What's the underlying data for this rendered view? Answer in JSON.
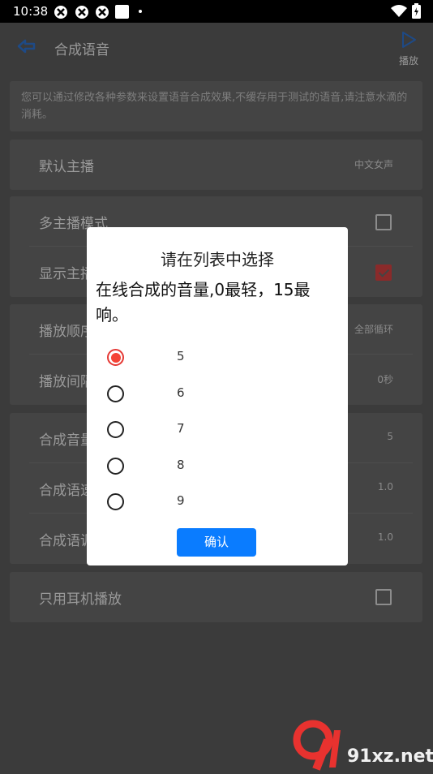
{
  "status_bar": {
    "time": "10:38"
  },
  "toolbar": {
    "title": "合成语音",
    "play_label": "播放"
  },
  "description": "您可以通过修改各种参数来设置语音合成效果,不缓存用于测试的语音,请注意水滴的消耗。",
  "settings": {
    "default_voice": {
      "label": "默认主播",
      "value": "中文女声"
    },
    "multi_voice": {
      "label": "多主播模式",
      "checked": false
    },
    "show_voice": {
      "label": "显示主播",
      "checked": true
    },
    "play_order": {
      "label": "播放顺序",
      "value": "全部循环"
    },
    "play_interval": {
      "label": "播放间隔",
      "value": "0秒"
    },
    "volume": {
      "label": "合成音量",
      "value": "5"
    },
    "speed": {
      "label": "合成语速",
      "value": "1.0"
    },
    "pitch": {
      "label": "合成语调",
      "value": "1.0"
    },
    "earphone_only": {
      "label": "只用耳机播放",
      "checked": false
    }
  },
  "dialog": {
    "title": "请在列表中选择",
    "message": "在线合成的音量,0最轻，15最响。",
    "options": [
      {
        "label": "5",
        "selected": true
      },
      {
        "label": "6",
        "selected": false
      },
      {
        "label": "7",
        "selected": false
      },
      {
        "label": "8",
        "selected": false
      },
      {
        "label": "9",
        "selected": false
      }
    ],
    "confirm_label": "确认"
  },
  "watermark": {
    "text": "91xz.net"
  },
  "colors": {
    "accent": "#0a7cff",
    "radio_selected": "#f44336",
    "overlay": "#3b3b3b"
  }
}
